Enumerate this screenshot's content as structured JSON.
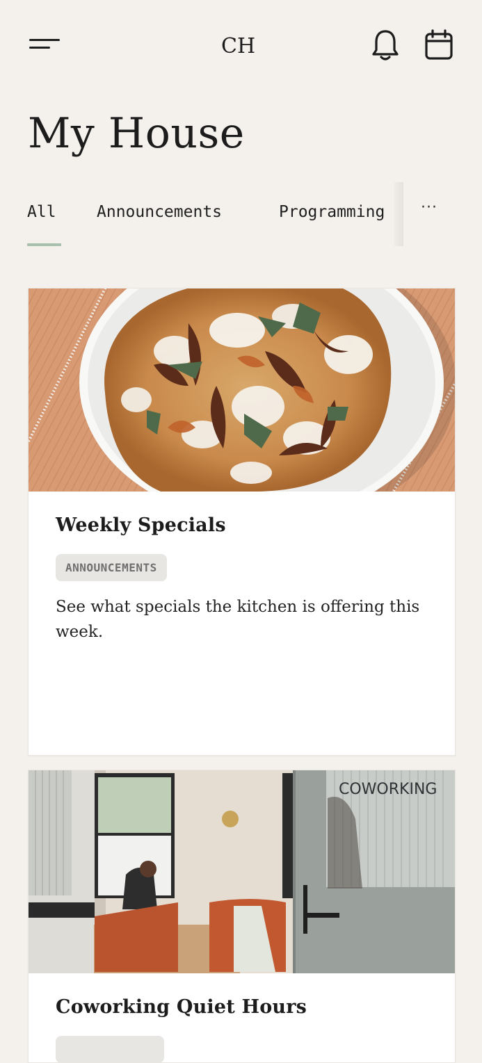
{
  "header": {
    "menu_icon": "menu-icon",
    "logo_text": "CH",
    "notifications_icon": "bell-icon",
    "calendar_icon": "calendar-icon"
  },
  "page": {
    "title": "My House"
  },
  "tabs": {
    "items": [
      {
        "label": "All",
        "selected": true
      },
      {
        "label": "Announcements",
        "selected": false
      },
      {
        "label": "Programming",
        "selected": false
      }
    ],
    "more_label": "···",
    "accent_color": "#a9bfae"
  },
  "cards": [
    {
      "title": "Weekly Specials",
      "category": "ANNOUNCEMENTS",
      "description": "See what specials the kitchen is offering this week.",
      "image": "pizza-photo"
    },
    {
      "title": "Coworking Quiet Hours",
      "image": "coworking-lounge-photo",
      "image_sign_text": "COWORKING"
    }
  ]
}
